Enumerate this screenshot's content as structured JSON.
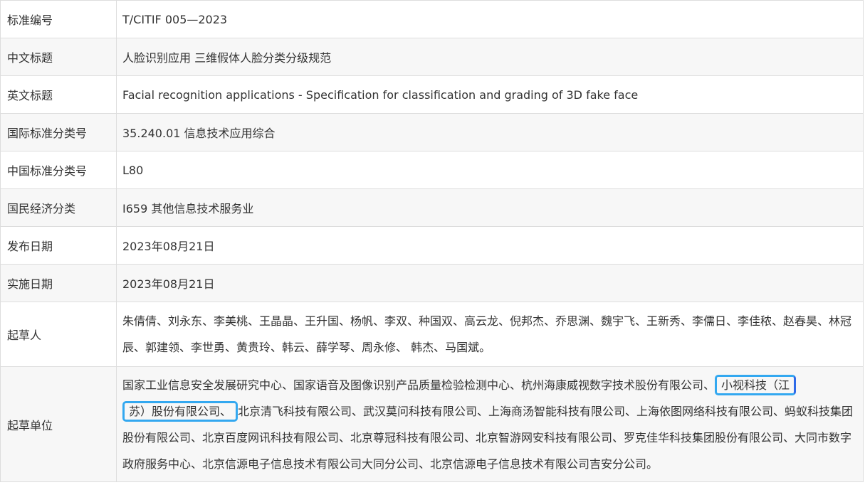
{
  "rows": [
    {
      "label": "标准编号",
      "value": "T/CITIF 005—2023"
    },
    {
      "label": "中文标题",
      "value": "人脸识别应用 三维假体人脸分类分级规范"
    },
    {
      "label": "英文标题",
      "value": "Facial recognition applications - Specification for classification and grading of 3D fake face"
    },
    {
      "label": "国际标准分类号",
      "value": "35.240.01 信息技术应用综合"
    },
    {
      "label": "中国标准分类号",
      "value": "L80"
    },
    {
      "label": "国民经济分类",
      "value": "I659 其他信息技术服务业"
    },
    {
      "label": "发布日期",
      "value": "2023年08月21日"
    },
    {
      "label": "实施日期",
      "value": "2023年08月21日"
    }
  ],
  "drafters": {
    "label": "起草人",
    "value": "朱倩倩、刘永东、李美桃、王晶晶、王升国、杨帆、李双、种国双、高云龙、倪邦杰、乔思渊、魏宇飞、王新秀、李儒日、李佳秾、赵春昊、林冠辰、郭建领、李世勇、黄贵玲、韩云、薛学琴、周永修、 韩杰、马国斌。"
  },
  "units": {
    "label": "起草单位",
    "before": "国家工业信息安全发展研究中心、国家语音及图像识别产品质量检验检测中心、杭州海康威视数字技术股份有限公司、",
    "highlight_1": "小视科技（江",
    "highlight_2": "苏）股份有限公司、",
    "after": "北京清飞科技有限公司、武汉莫问科技有限公司、上海商汤智能科技有限公司、上海依图网络科技有限公司、蚂蚁科技集团股份有限公司、北京百度网讯科技有限公司、北京尊冠科技有限公司、北京智游网安科技有限公司、罗克佳华科技集团股份有限公司、大同市数字政府服务中心、北京信源电子信息技术有限公司大同分公司、北京信源电子信息技术有限公司吉安分公司。"
  },
  "colors": {
    "border": "#dddddd",
    "alt_row": "#f7f7f7",
    "highlight": "#33a8f0"
  }
}
